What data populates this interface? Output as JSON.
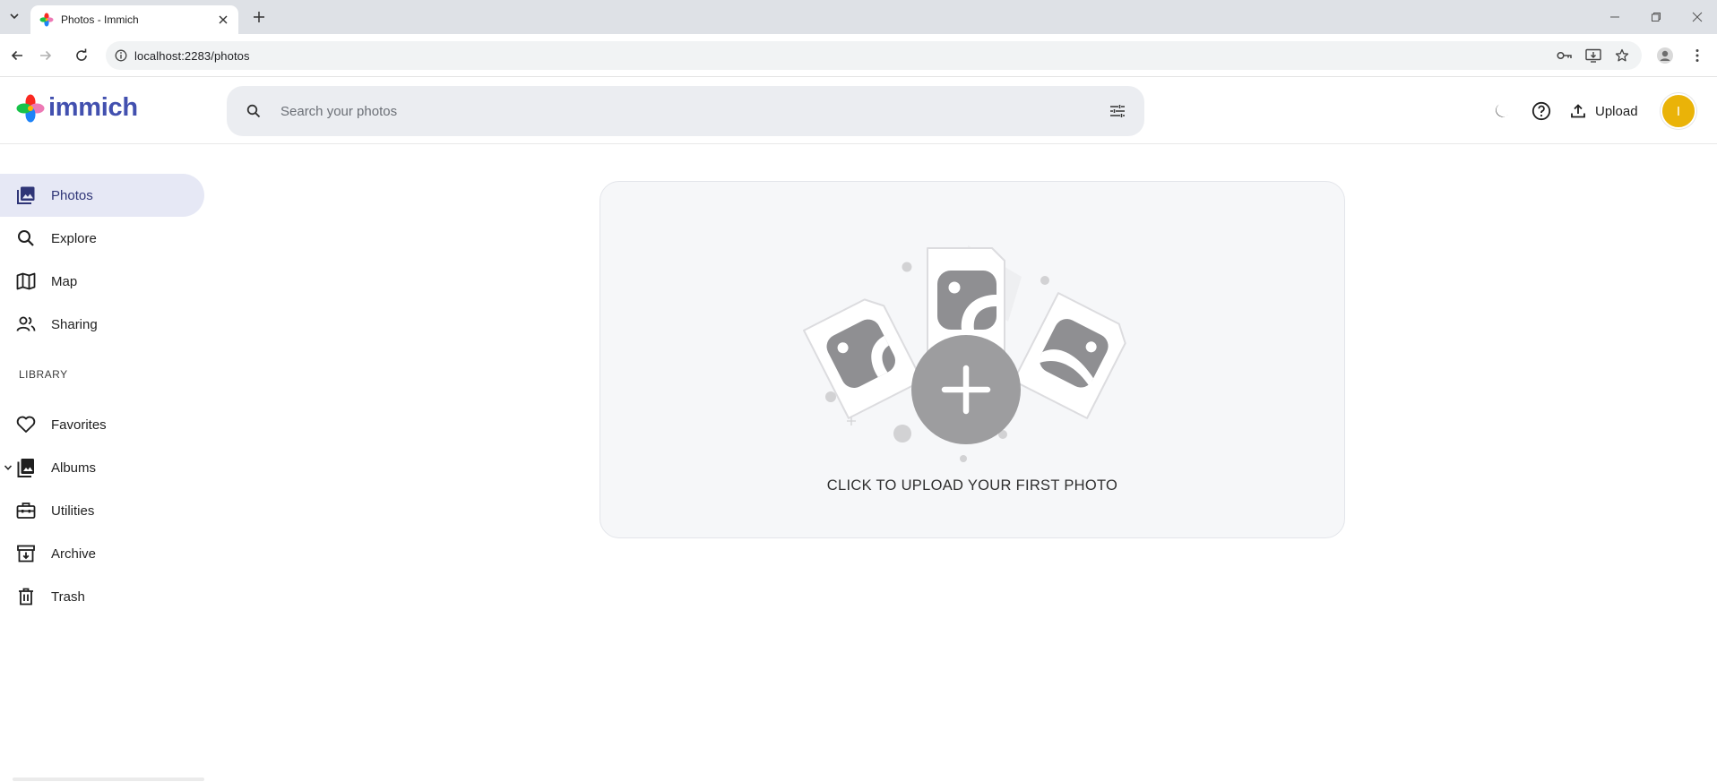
{
  "browser": {
    "tab_title": "Photos - Immich",
    "url": "localhost:2283/photos"
  },
  "app": {
    "logo_text": "immich",
    "brand_color": "#4250af",
    "search": {
      "placeholder": "Search your photos"
    },
    "upload_label": "Upload",
    "avatar_initial": "I",
    "avatar_color": "#eab308"
  },
  "sidebar": {
    "items": [
      {
        "label": "Photos",
        "icon": "photos-icon",
        "active": true
      },
      {
        "label": "Explore",
        "icon": "search-icon"
      },
      {
        "label": "Map",
        "icon": "map-icon"
      },
      {
        "label": "Sharing",
        "icon": "people-icon"
      }
    ],
    "library_heading": "LIBRARY",
    "library_items": [
      {
        "label": "Favorites",
        "icon": "heart-icon"
      },
      {
        "label": "Albums",
        "icon": "albums-icon",
        "expandable": true
      },
      {
        "label": "Utilities",
        "icon": "toolbox-icon"
      },
      {
        "label": "Archive",
        "icon": "archive-icon"
      },
      {
        "label": "Trash",
        "icon": "trash-icon"
      }
    ]
  },
  "main": {
    "empty_state_text": "CLICK TO UPLOAD YOUR FIRST PHOTO"
  }
}
